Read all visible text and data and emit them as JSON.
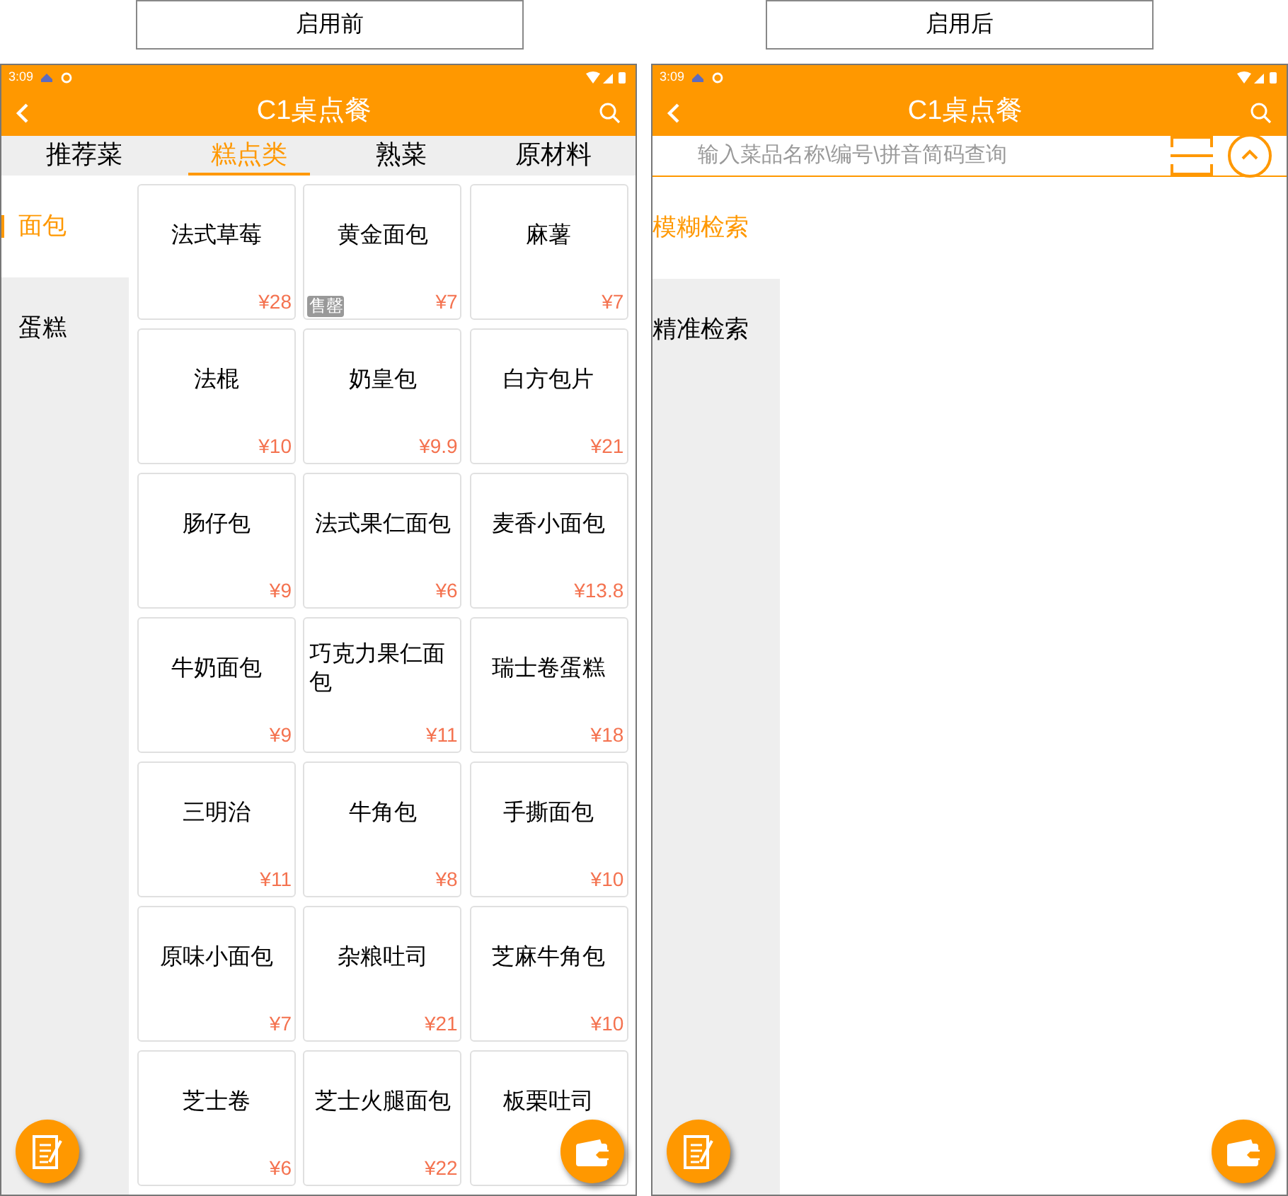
{
  "captions": [
    "启用前",
    "启用后"
  ],
  "before": {
    "status_bar": {
      "time": "3:09"
    },
    "title": "C1桌点餐",
    "tabs": [
      {
        "label": "推荐菜",
        "selected": false
      },
      {
        "label": "糕点类",
        "selected": true
      },
      {
        "label": "熟菜",
        "selected": false
      },
      {
        "label": "原材料",
        "selected": false
      }
    ],
    "sidebar": [
      {
        "label": "面包",
        "selected": true
      },
      {
        "label": "蛋糕",
        "selected": false
      }
    ],
    "dishes": [
      {
        "name": "法式草莓",
        "price": "¥28"
      },
      {
        "name": "黄金面包",
        "price": "¥7",
        "badge": "售罄"
      },
      {
        "name": "麻薯",
        "price": "¥7"
      },
      {
        "name": "法棍",
        "price": "¥10"
      },
      {
        "name": "奶皇包",
        "price": "¥9.9"
      },
      {
        "name": "白方包片",
        "price": "¥21"
      },
      {
        "name": "肠仔包",
        "price": "¥9"
      },
      {
        "name": "法式果仁面包",
        "price": "¥6"
      },
      {
        "name": "麦香小面包",
        "price": "¥13.8"
      },
      {
        "name": "牛奶面包",
        "price": "¥9"
      },
      {
        "name": "巧克力果仁面包",
        "price": "¥11"
      },
      {
        "name": "瑞士卷蛋糕",
        "price": "¥18"
      },
      {
        "name": "三明治",
        "price": "¥11"
      },
      {
        "name": "牛角包",
        "price": "¥8"
      },
      {
        "name": "手撕面包",
        "price": "¥10"
      },
      {
        "name": "原味小面包",
        "price": "¥7"
      },
      {
        "name": "杂粮吐司",
        "price": "¥21"
      },
      {
        "name": "芝麻牛角包",
        "price": "¥10"
      },
      {
        "name": "芝士卷",
        "price": "¥6"
      },
      {
        "name": "芝士火腿面包",
        "price": "¥22"
      },
      {
        "name": "板栗吐司"
      }
    ]
  },
  "after": {
    "status_bar": {
      "time": "3:09"
    },
    "title": "C1桌点餐",
    "search": {
      "placeholder": "输入菜品名称\\编号\\拼音简码查询"
    },
    "sidebar": [
      {
        "label": "模糊检索",
        "selected": true
      },
      {
        "label": "精准检索",
        "selected": false
      }
    ]
  }
}
